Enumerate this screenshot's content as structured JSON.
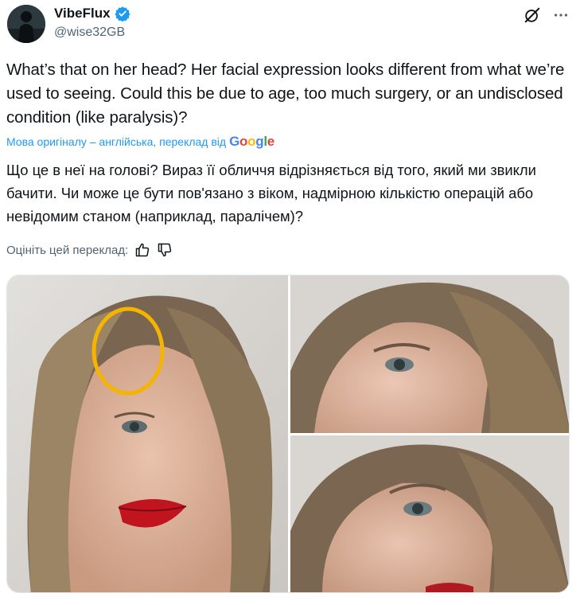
{
  "author": {
    "display_name": "VibeFlux",
    "handle": "@wise32GB",
    "avatar_icon": "avatar-silhouette",
    "verified_icon": "verified-badge-icon",
    "verified_color": "#1d9bf0"
  },
  "actions": {
    "grok_icon": "grok-icon",
    "more_icon": "more-options-icon"
  },
  "tweet": {
    "text": "What’s that on her head? Her facial expression looks different from what we’re used to seeing. Could this be due to age, too much surgery, or an undisclosed condition (like paralysis)?"
  },
  "translation": {
    "note": "Мова оригіналу – англійська, переклад від",
    "provider": "Google",
    "text": "Що це в неї на голові? Вираз її обличчя відрізняється від того, який ми звикли бачити. Чи може це бути пов'язано з віком, надмірною кількістю операцій або невідомим станом (наприклад, паралічем)?",
    "rate_label": "Оцініть цей переклад:",
    "thumbs_up_icon": "thumbs-up-icon",
    "thumbs_down_icon": "thumbs-down-icon"
  },
  "colors": {
    "text": "#0f1419",
    "secondary": "#536471",
    "link": "#1d9bf0",
    "highlight_circle": "#f5b400"
  }
}
